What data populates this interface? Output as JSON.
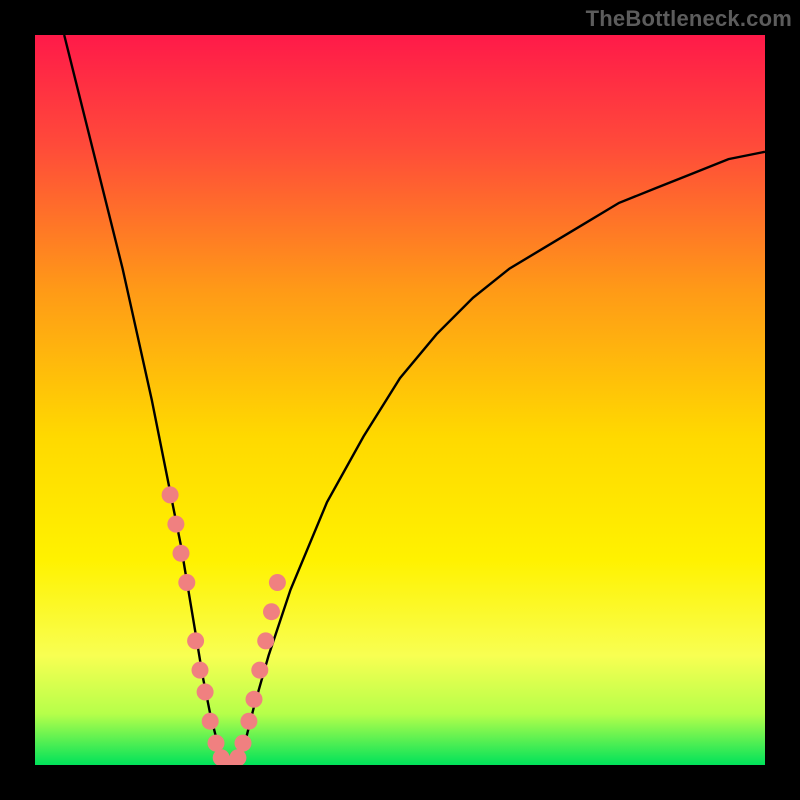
{
  "watermark": "TheBottleneck.com",
  "gradient": {
    "stops": [
      {
        "offset": 0.0,
        "color": "#ff1a49"
      },
      {
        "offset": 0.15,
        "color": "#ff4a3a"
      },
      {
        "offset": 0.35,
        "color": "#ff9a17"
      },
      {
        "offset": 0.55,
        "color": "#ffd900"
      },
      {
        "offset": 0.72,
        "color": "#fff200"
      },
      {
        "offset": 0.85,
        "color": "#f8ff52"
      },
      {
        "offset": 0.93,
        "color": "#b6ff4a"
      },
      {
        "offset": 1.0,
        "color": "#00e25a"
      }
    ]
  },
  "chart_data": {
    "type": "line",
    "title": "",
    "xlabel": "",
    "ylabel": "",
    "xlim": [
      0,
      100
    ],
    "ylim": [
      0,
      100
    ],
    "series": [
      {
        "name": "bottleneck-curve",
        "x": [
          4,
          6,
          8,
          10,
          12,
          14,
          16,
          18,
          19,
          20,
          21,
          22,
          23,
          24,
          25,
          26,
          27,
          28,
          29,
          30,
          32,
          35,
          40,
          45,
          50,
          55,
          60,
          65,
          70,
          75,
          80,
          85,
          90,
          95,
          100
        ],
        "values": [
          100,
          92,
          84,
          76,
          68,
          59,
          50,
          40,
          35,
          30,
          24,
          18,
          12,
          7,
          3,
          1,
          0,
          1,
          4,
          8,
          15,
          24,
          36,
          45,
          53,
          59,
          64,
          68,
          71,
          74,
          77,
          79,
          81,
          83,
          84
        ]
      }
    ],
    "markers": {
      "name": "highlight-points",
      "color": "#f08080",
      "x": [
        18.5,
        19.3,
        20.0,
        20.8,
        22.0,
        22.6,
        23.3,
        24.0,
        24.8,
        25.5,
        26.3,
        27.0,
        27.8,
        28.5,
        29.3,
        30.0,
        30.8,
        31.6,
        32.4,
        33.2
      ],
      "values": [
        37,
        33,
        29,
        25,
        17,
        13,
        10,
        6,
        3,
        1,
        0,
        0,
        1,
        3,
        6,
        9,
        13,
        17,
        21,
        25
      ]
    }
  }
}
